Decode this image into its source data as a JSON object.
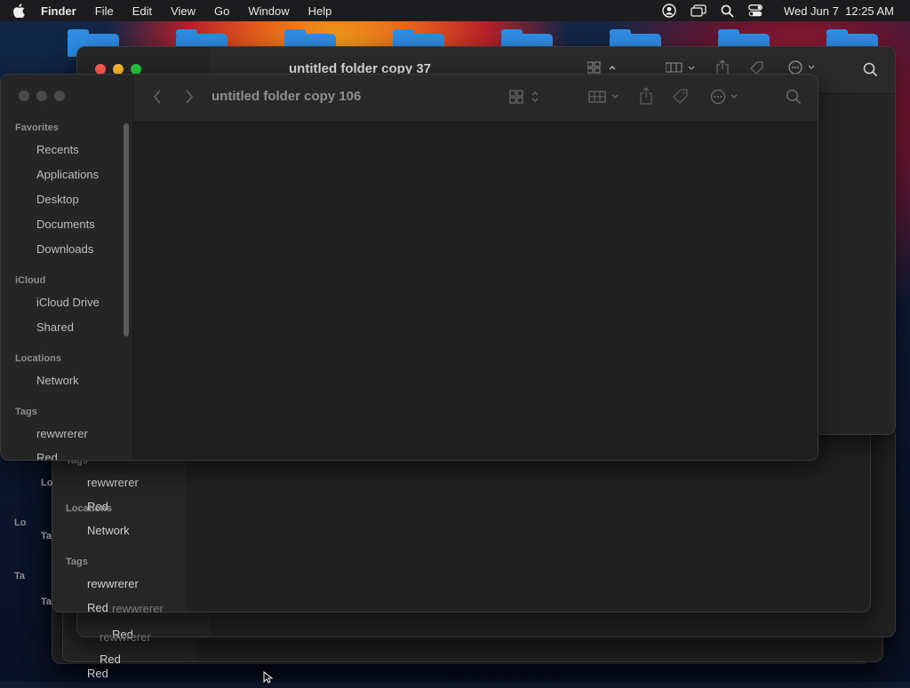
{
  "menubar": {
    "app": "Finder",
    "items": [
      "File",
      "Edit",
      "View",
      "Go",
      "Window",
      "Help"
    ],
    "clock": "Wed Jun 7  12:25 AM"
  },
  "back_window": {
    "title": "untitled folder copy 37"
  },
  "front_window": {
    "title": "untitled folder copy 106",
    "sidebar": {
      "favorites_head": "Favorites",
      "favorites": [
        "Recents",
        "Applications",
        "Desktop",
        "Documents",
        "Downloads"
      ],
      "icloud_head": "iCloud",
      "icloud": [
        "iCloud Drive",
        "Shared"
      ],
      "locations_head": "Locations",
      "locations": [
        "Network"
      ],
      "tags_head": "Tags",
      "tags": [
        "rewwrerer",
        "Red"
      ]
    }
  },
  "stack_windows": {
    "tags_head": "Tags",
    "tag1": "rewwrerer",
    "tag2": "Red",
    "locations_head": "Locations",
    "network": "Network",
    "lo_partial": "Lo",
    "ta_partial": "Ta"
  }
}
